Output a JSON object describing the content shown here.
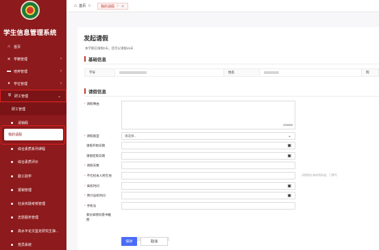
{
  "app": {
    "title": "学生信息管理系统"
  },
  "sidebar": {
    "home": "首页",
    "menus": [
      {
        "label": "学籍管理",
        "icon": "academic-icon"
      },
      {
        "label": "培养管理",
        "icon": "book-icon"
      },
      {
        "label": "学位管理",
        "icon": "mortarboard-icon"
      },
      {
        "label": "研工管理",
        "icon": "shield-icon",
        "expanded": true
      }
    ],
    "group_label": "研工管理",
    "items": [
      "请销假",
      "我的请假",
      "综合素质系列课程",
      "综合素质评价",
      "勤工助学",
      "报销管理",
      "社会实践考核管理",
      "志愿服务管理",
      "高水平论文鉴定研究生弹...",
      "党员系统"
    ],
    "active_item": "我的请假"
  },
  "tabs": {
    "home": "首页",
    "active": "我的请假"
  },
  "page": {
    "title": "发起请假",
    "quota": "本学期已请假0天，还可以请假45天"
  },
  "basic_info": {
    "title": "基础信息",
    "student_id_label": "学号",
    "name_label": "姓名",
    "more_label": "院"
  },
  "leave_info": {
    "title": "请假信息",
    "reason_label": "请假事由",
    "reason_count": "0/3000",
    "type_label": "请假类型",
    "type_placeholder": "请选择...",
    "start_label": "请假开始日期",
    "end_label": "请假结束日期",
    "days_label": "请假天数",
    "location_label": "不在校本人所在地",
    "location_hint": "详细地址具体到街道、门牌号",
    "leave_time_label": "离校时间",
    "return_time_label": "预计返校时间",
    "phone_label": "手机号",
    "parent_label": "家长知晓同意书截图"
  },
  "actions": {
    "save": "保存",
    "cancel": "取消"
  },
  "colors": {
    "sidebar": "#8d1a1c",
    "accent": "#c0392b",
    "primary_button": "#4a6cf7",
    "highlight_border": "#e02020"
  }
}
